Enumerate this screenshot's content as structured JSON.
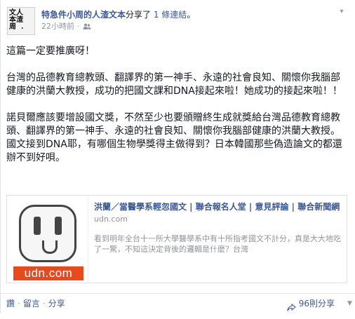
{
  "header": {
    "author": "特急件小周的人渣文本",
    "shared_prefix": "分享了",
    "link_label": "1 條連結",
    "shared_suffix": "。",
    "timestamp": "22小時前",
    "avatar_text": "文人\n本渣\n周  ."
  },
  "post": {
    "paragraphs": [
      "這篇一定要推廣呀！",
      "台灣的品德教育總教頭、翻譯界的第一神手、永遠的社會良知、關懷你我腦部健康的洪蘭大教授，成功的把國文課和DNA接起來啦！她成功的接起來啦！！",
      "諾貝爾應該要增設國文獎，不然至少也要頒贈終生成就獎給台灣品德教育總教頭、翻譯界的第一神手、永遠的社會良知、關懷你我腦部健康的洪蘭大教授。國文接到DNA耶，有哪個生物學獎得主做得到？日本韓國那些偽造論文的都還辦不到好唄。"
    ]
  },
  "attachment": {
    "title": "洪蘭／當醫學系輕忽國文 | 聯合報名人堂 | 意見評論 | 聯合新聞網",
    "domain": "udn.com",
    "description": "看到明年全台十一所大學醫學系中有十所指考國文不計分，真是大大地吃了一驚，不知這決定背後的邏輯是什麼？台灣",
    "thumb_text": "udn.com"
  },
  "footer": {
    "like": "讚",
    "comment": "留言",
    "share": "分享",
    "share_count": "96則分享",
    "separator": "·"
  },
  "colors": {
    "link": "#3b5998",
    "meta": "#9197a3",
    "udn_brand": "#e84a1d"
  },
  "icons": {
    "audience": "friends-icon",
    "menu": "chevron-down-icon",
    "share": "share-arrow-icon"
  }
}
